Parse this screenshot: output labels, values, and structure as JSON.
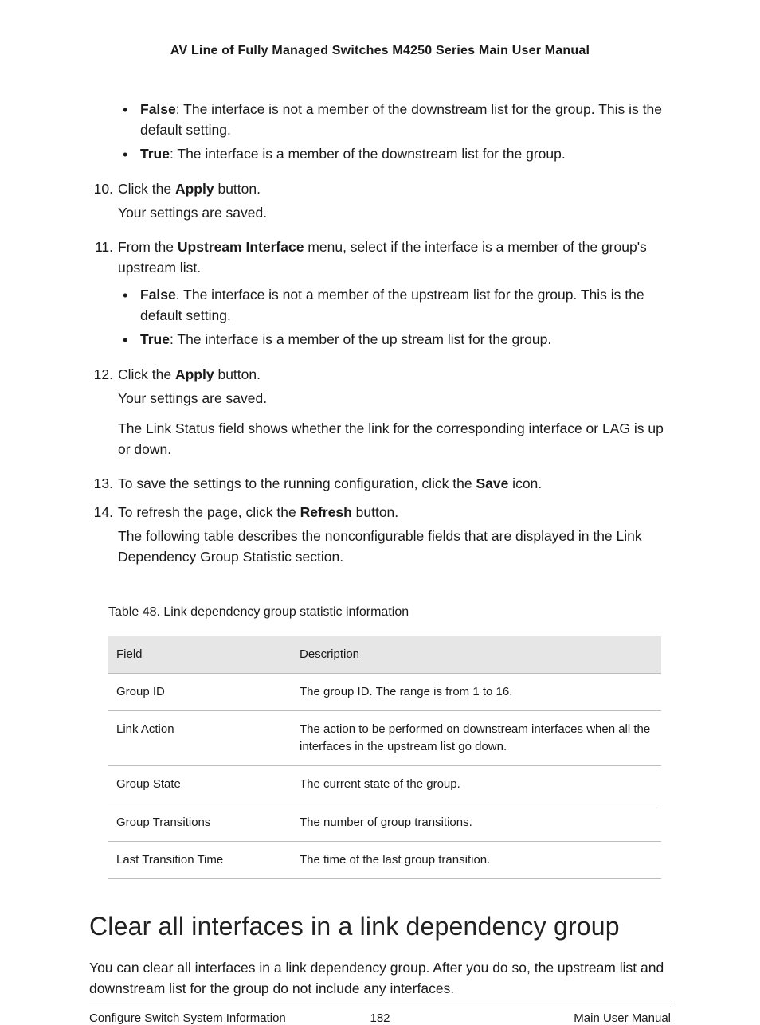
{
  "header": {
    "title": "AV Line of Fully Managed Switches M4250 Series Main User Manual"
  },
  "bullets_a": {
    "b1_label": "False",
    "b1_text": ": The interface is not a member of the downstream list for the group. This is the default setting.",
    "b2_label": "True",
    "b2_text": ": The interface is a member of the downstream list for the group."
  },
  "step10": {
    "num": "10.",
    "line1_pre": "Click the ",
    "line1_b": "Apply",
    "line1_post": " button.",
    "line2": "Your settings are saved."
  },
  "step11": {
    "num": "11.",
    "line1_pre": "From the ",
    "line1_b": "Upstream Interface",
    "line1_post": " menu, select if the interface is a member of the group's upstream list.",
    "b1_label": "False",
    "b1_text": ". The interface is not a member of the upstream list for the group. This is the default setting.",
    "b2_label": "True",
    "b2_text": ": The interface is a member of the up stream list for the group."
  },
  "step12": {
    "num": "12.",
    "line1_pre": "Click the ",
    "line1_b": "Apply",
    "line1_post": " button.",
    "line2": "Your settings are saved.",
    "line3": "The Link Status field shows whether the link for the corresponding interface or LAG is up or down."
  },
  "step13": {
    "num": "13.",
    "line1_pre": "To save the settings to the running configuration, click the ",
    "line1_b": "Save",
    "line1_post": " icon."
  },
  "step14": {
    "num": "14.",
    "line1_pre": "To refresh the page, click the ",
    "line1_b": "Refresh",
    "line1_post": " button.",
    "line2": "The following table describes the nonconfigurable fields that are displayed in the Link Dependency Group Statistic section."
  },
  "table": {
    "caption": "Table 48. Link dependency group statistic information",
    "headers": {
      "field": "Field",
      "desc": "Description"
    },
    "rows": [
      {
        "field": "Group ID",
        "desc": "The group ID. The range is from 1 to 16."
      },
      {
        "field": "Link Action",
        "desc": "The action to be performed on downstream interfaces when all the interfaces in the upstream list go down."
      },
      {
        "field": "Group State",
        "desc": "The current state of the group."
      },
      {
        "field": "Group Transitions",
        "desc": "The number of group transitions."
      },
      {
        "field": "Last Transition Time",
        "desc": "The time of the last group transition."
      }
    ]
  },
  "section": {
    "heading": "Clear all interfaces in a link dependency group",
    "para": "You can clear all interfaces in a link dependency group. After you do so, the upstream list and downstream list for the group do not include any interfaces."
  },
  "footer": {
    "left": "Configure Switch System Information",
    "center": "182",
    "right": "Main User Manual"
  }
}
